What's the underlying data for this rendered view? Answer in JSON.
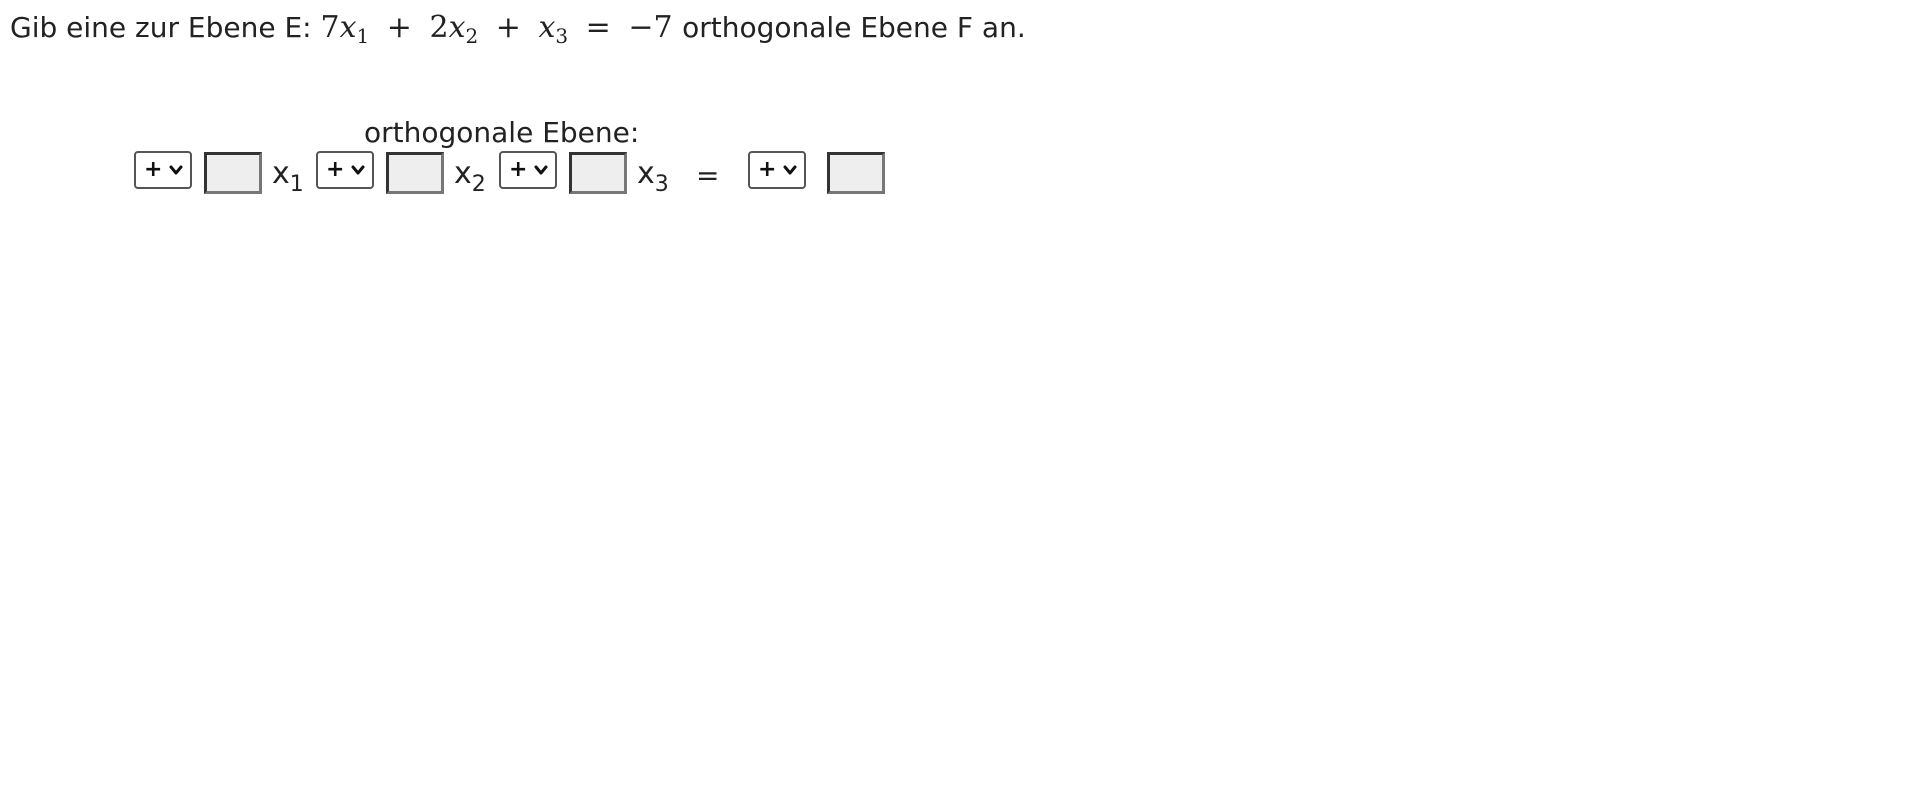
{
  "question": {
    "prefix": "Gib eine zur Ebene E:",
    "math": {
      "c1": "7",
      "v1": "x",
      "s1": "1",
      "op1": "+",
      "c2": "2",
      "v2": "x",
      "s2": "2",
      "op2": "+",
      "v3": "x",
      "s3": "3",
      "eq": "=",
      "rhs": "−7"
    },
    "suffix": "orthogonale Ebene F an."
  },
  "answer": {
    "title": "orthogonale Ebene:",
    "sign_options": [
      "+"
    ],
    "sign1": "+",
    "sign2": "+",
    "sign3": "+",
    "sign4": "+",
    "coef1": "",
    "coef2": "",
    "coef3": "",
    "rhs_value": "",
    "var1": {
      "base": "x",
      "sub": "1"
    },
    "var2": {
      "base": "x",
      "sub": "2"
    },
    "var3": {
      "base": "x",
      "sub": "3"
    },
    "equals": "="
  }
}
